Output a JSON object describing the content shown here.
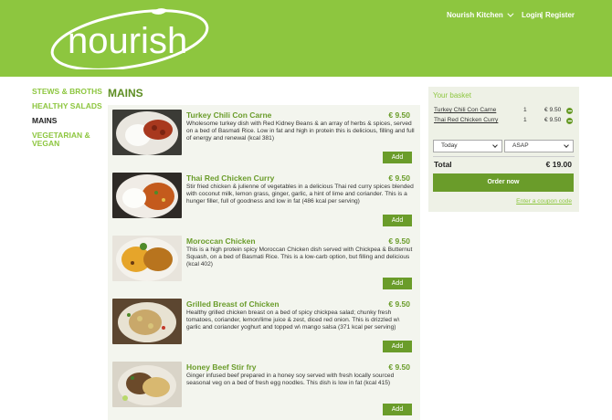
{
  "header": {
    "logo_text": "nourish",
    "location": "Nourish Kitchen",
    "login": "Login",
    "separator": "|",
    "register": "Register",
    "bg_color": "#8dc63f"
  },
  "sidebar": {
    "items": [
      {
        "label": "STEWS & BROTHS",
        "active": false
      },
      {
        "label": "HEALTHY SALADS",
        "active": false
      },
      {
        "label": "MAINS",
        "active": true
      },
      {
        "label": "VEGETARIAN & VEGAN",
        "active": false
      }
    ]
  },
  "main": {
    "title": "MAINS",
    "items": [
      {
        "name": "Turkey Chili Con Carne",
        "price": "€ 9.50",
        "description": "Wholesome turkey dish with Red Kidney Beans & an array of herbs & spices, served on a bed of Basmati Rice. Low in fat and high in protein this is delicious, filling and full of energy and renewal (kcal 381)",
        "add_label": "Add"
      },
      {
        "name": "Thai Red Chicken Curry",
        "price": "€ 9.50",
        "description": "Stir fried chicken & julienne of vegetables in a delicious Thai red curry spices blended with coconut milk, lemon grass, ginger, garlic, a hint of lime and coriander. This is a hunger filler, full of goodness and low in fat (486 kcal per serving)",
        "add_label": "Add"
      },
      {
        "name": "Moroccan Chicken",
        "price": "€ 9.50",
        "description": "This is a high protein spicy Moroccan Chicken dish served with Chickpea & Butternut Squash, on a bed of Basmati Rice. This is a low-carb option, but filling and delicious (kcal 402)",
        "add_label": "Add"
      },
      {
        "name": "Grilled Breast of Chicken",
        "price": "€ 9.50",
        "description": "Healthy grilled chicken breast on a bed of spicy chickpea salad; chunky fresh tomatoes, coriander, lemon/lime juice & zest, diced red onion. This is drizzled w\\ garlic and coriander yoghurt and topped w\\ mango salsa (371 kcal per serving)",
        "add_label": "Add"
      },
      {
        "name": "Honey Beef Stir fry",
        "price": "€ 9.50",
        "description": "Ginger infused beef prepared in a honey soy served with fresh locally sourced seasonal veg on a bed of fresh egg noodles. This dish is low in fat (kcal 415)",
        "add_label": "Add"
      }
    ]
  },
  "basket": {
    "title": "Your basket",
    "items": [
      {
        "name": "Turkey Chili Con Carne",
        "qty": "1",
        "price": "€ 9.50"
      },
      {
        "name": "Thai Red Chicken Curry",
        "qty": "1",
        "price": "€ 9.50"
      }
    ],
    "day_select": "Today",
    "time_select": "ASAP",
    "total_label": "Total",
    "total_value": "€ 19.00",
    "order_label": "Order now",
    "coupon_label": "Enter a coupon code"
  }
}
